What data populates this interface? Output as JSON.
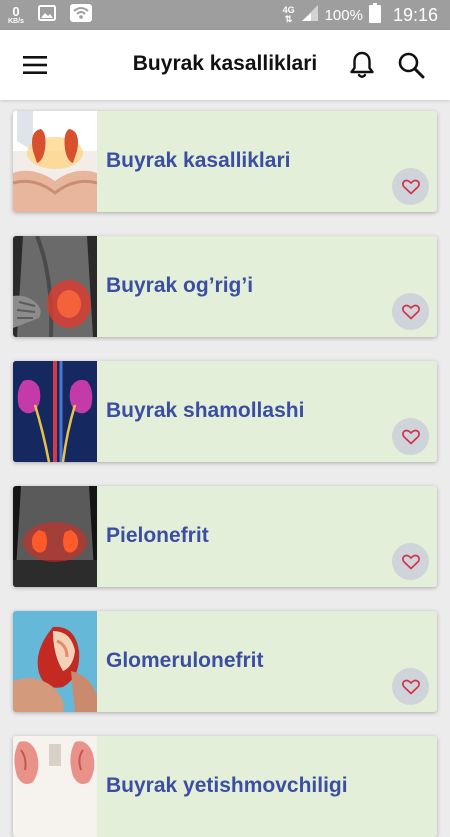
{
  "status_bar": {
    "data_speed": "0",
    "data_unit": "KB/s",
    "network": "4G",
    "battery": "100%",
    "time": "19:16",
    "icons": [
      "image-icon",
      "wifi-icon",
      "signal-icon",
      "battery-icon"
    ]
  },
  "app_bar": {
    "title": "Buyrak kasalliklari",
    "icons": [
      "menu-icon",
      "bell-icon",
      "search-icon"
    ]
  },
  "items": [
    {
      "title": "Buyrak kasalliklari",
      "thumb": "hands-holding-kidneys"
    },
    {
      "title": "Buyrak og’rig’i",
      "thumb": "back-pain"
    },
    {
      "title": "Buyrak shamollashi",
      "thumb": "inflamed-kidneys"
    },
    {
      "title": "Pielonefrit",
      "thumb": "glowing-kidneys-on-back"
    },
    {
      "title": "Glomerulonefrit",
      "thumb": "kidney-anatomy-model"
    },
    {
      "title": "Buyrak yetishmovchiligi",
      "thumb": "kidney-illustration"
    }
  ],
  "colors": {
    "card_bg": "#e4efd9",
    "card_title": "#3b4ea2",
    "heart": "#d0344a",
    "status_bar": "#9e9e9e"
  }
}
